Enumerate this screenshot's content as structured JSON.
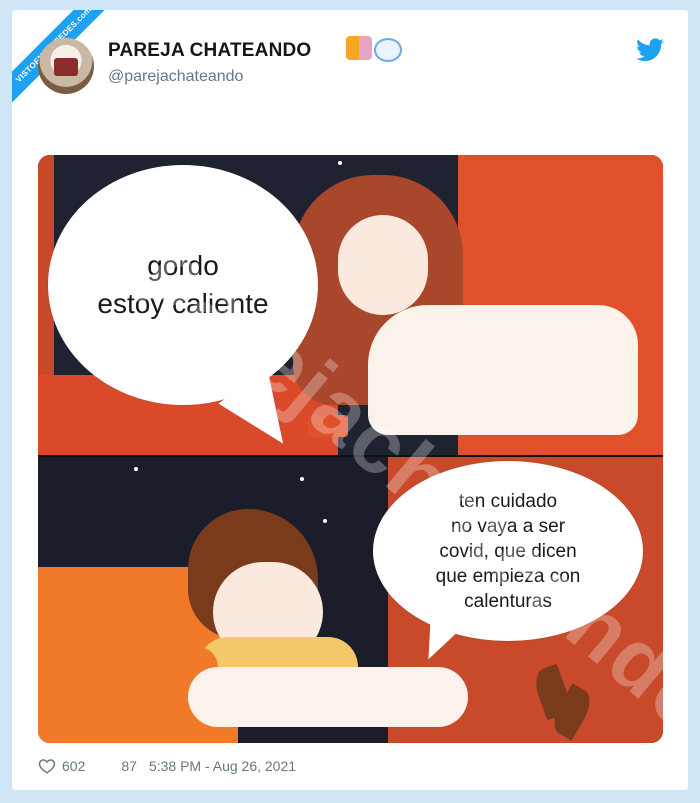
{
  "watermark_corner": "VISTOENLASREDES.com",
  "tweet": {
    "display_name": "PAREJA CHATEANDO",
    "name_emoji": [
      "couple-emoji",
      "speech-bubble-emoji"
    ],
    "handle": "@parejachateando",
    "image_watermark": "@parejachateando"
  },
  "meme": {
    "top_bubble": "gordo\nestoy caliente",
    "bottom_bubble": "ten cuidado\nno vaya a ser\ncovid, que dicen\nque empieza con\ncalenturas"
  },
  "footer": {
    "likes": "602",
    "retweets": "87",
    "timestamp": "5:38 PM - Aug 26, 2021"
  },
  "colors": {
    "twitter_blue": "#1da1f2",
    "page_bg": "#cfe6f7",
    "meme_orange": "#e0512b"
  }
}
